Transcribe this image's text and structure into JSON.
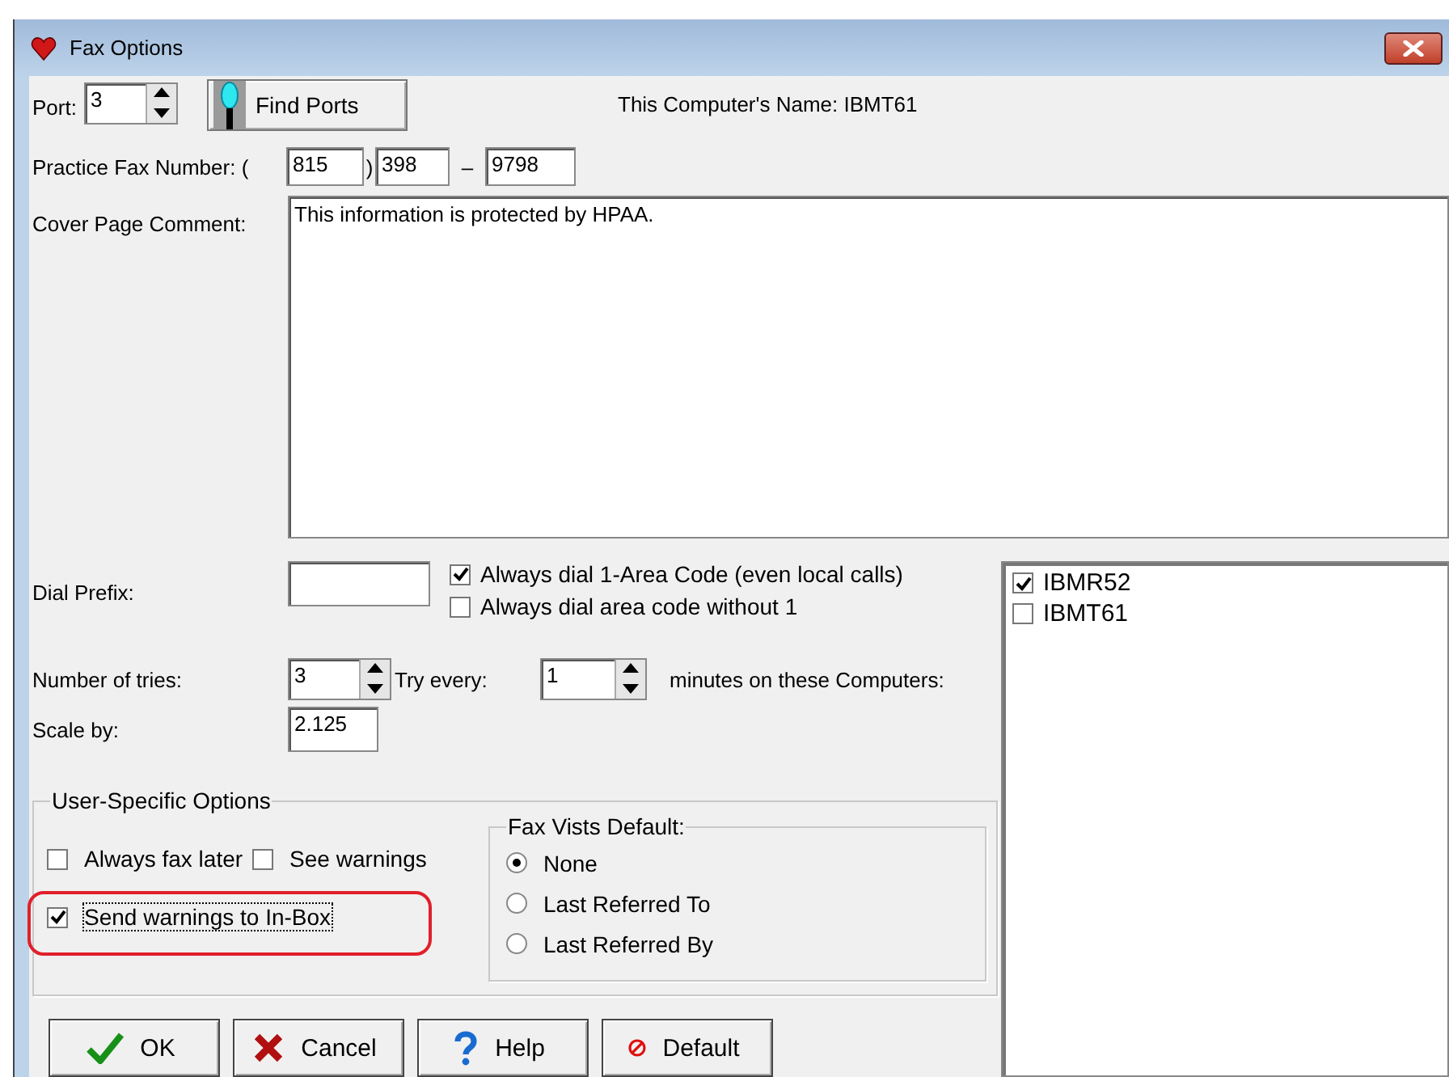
{
  "window": {
    "title": "Fax Options"
  },
  "port": {
    "label": "Port:",
    "value": "3"
  },
  "find_ports_button": "Find Ports",
  "computer_name": "This Computer's Name: IBMT61",
  "fax_number": {
    "label": "Practice Fax Number:",
    "open_paren": "(",
    "area": "815",
    "close_paren": ")",
    "prefix": "398",
    "dash": "–",
    "line": "9798"
  },
  "cover_comment": {
    "label": "Cover Page Comment:",
    "value": "This information is protected by HPAA."
  },
  "dial_prefix": {
    "label": "Dial Prefix:"
  },
  "dial_options": [
    {
      "label": "Always dial 1-Area Code (even local calls)",
      "checked": true
    },
    {
      "label": "Always dial area code without 1",
      "checked": false
    }
  ],
  "tries": {
    "label": "Number of tries:",
    "value": "3"
  },
  "retry": {
    "label": "Try every:",
    "value": "1",
    "suffix": "minutes on these Computers:"
  },
  "scale": {
    "label": "Scale by:",
    "value": "2.125"
  },
  "computers": [
    {
      "name": "IBMR52",
      "checked": true
    },
    {
      "name": "IBMT61",
      "checked": false
    }
  ],
  "user_options": {
    "title": "User-Specific Options",
    "rows": [
      [
        {
          "label": "Always fax later",
          "checked": false,
          "focused": false,
          "circled": false
        },
        {
          "label": "See warnings",
          "checked": false,
          "focused": false,
          "circled": false
        }
      ],
      [
        {
          "label": "Send warnings to In-Box",
          "checked": true,
          "focused": true,
          "circled": true
        }
      ]
    ]
  },
  "fax_vists_default": {
    "title": "Fax Vists Default:",
    "options": [
      {
        "label": "None",
        "selected": true
      },
      {
        "label": "Last Referred To",
        "selected": false
      },
      {
        "label": "Last Referred By",
        "selected": false
      }
    ]
  },
  "buttons": [
    {
      "label": "OK",
      "kind": "ok"
    },
    {
      "label": "Cancel",
      "kind": "cancel"
    },
    {
      "label": "Help",
      "kind": "help"
    },
    {
      "label": "Default",
      "kind": "default"
    }
  ]
}
